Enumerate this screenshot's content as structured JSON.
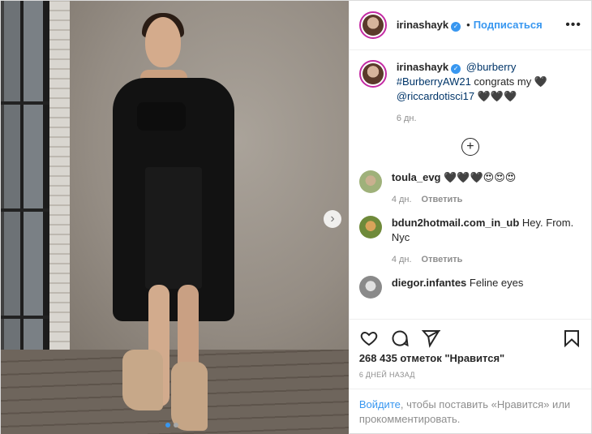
{
  "header": {
    "username": "irinashayk",
    "separator": "•",
    "follow_label": "Подписаться",
    "more_icon": "more-horizontal-icon"
  },
  "caption": {
    "username": "irinashayk",
    "mention": "@burberry",
    "hashtag": "#BurberryAW21",
    "text": " congrats my 🖤",
    "mention2": "@riccardotisci17",
    "emojis": " 🖤🖤🖤",
    "time": "6 дн."
  },
  "load_more_icon": "plus-circle-icon",
  "comments": [
    {
      "username": "toula_evg",
      "text": "🖤🖤🖤😍😍😍",
      "time": "4 дн.",
      "reply": "Ответить",
      "avatar_color": "#b5c39a"
    },
    {
      "username": "bdun2hotmail.com_in_ub",
      "text": "Hey. From. Nyc",
      "time": "4 дн.",
      "reply": "Ответить",
      "avatar_color": "#8a9a55"
    },
    {
      "username": "diegor.infantes",
      "text": "Feline eyes",
      "avatar_color": "#9a9a9a"
    }
  ],
  "actions": {
    "like_icon": "heart-icon",
    "comment_icon": "comment-icon",
    "share_icon": "send-icon",
    "save_icon": "bookmark-icon"
  },
  "likes": "268 435 отметок \"Нравится\"",
  "date": "6 дней назад",
  "login": {
    "link": "Войдите",
    "text": ", чтобы поставить «Нравится» или прокомментировать."
  },
  "carousel": {
    "current": 1,
    "total": 2
  },
  "colors": {
    "accent": "#3897f0",
    "muted": "#8e8e8e"
  }
}
